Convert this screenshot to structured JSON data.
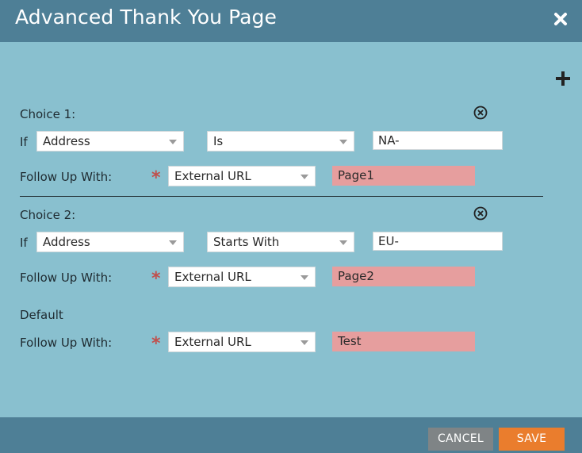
{
  "dialog": {
    "title": "Advanced Thank You Page"
  },
  "icons": {
    "close": "close-icon",
    "add": "plus-icon",
    "remove": "remove-circle-icon"
  },
  "choices": [
    {
      "label": "Choice 1:",
      "if_label": "If",
      "field": "Address",
      "operator": "Is",
      "value": "NA-",
      "follow_up_label": "Follow Up With:",
      "follow_up_type": "External URL",
      "url": "Page1"
    },
    {
      "label": "Choice 2:",
      "if_label": "If",
      "field": "Address",
      "operator": "Starts With",
      "value": "EU-",
      "follow_up_label": "Follow Up With:",
      "follow_up_type": "External URL",
      "url": "Page2"
    }
  ],
  "default": {
    "label": "Default",
    "follow_up_label": "Follow Up With:",
    "follow_up_type": "External URL",
    "url": "Test"
  },
  "required_marker": "*",
  "footer": {
    "cancel_label": "CANCEL",
    "save_label": "SAVE"
  },
  "colors": {
    "header": "#4e7f96",
    "body": "#89c0cf",
    "url_input": "#e69e9e",
    "save_button": "#ea7d2d",
    "cancel_button": "#7f8486",
    "required": "#c0504d"
  }
}
